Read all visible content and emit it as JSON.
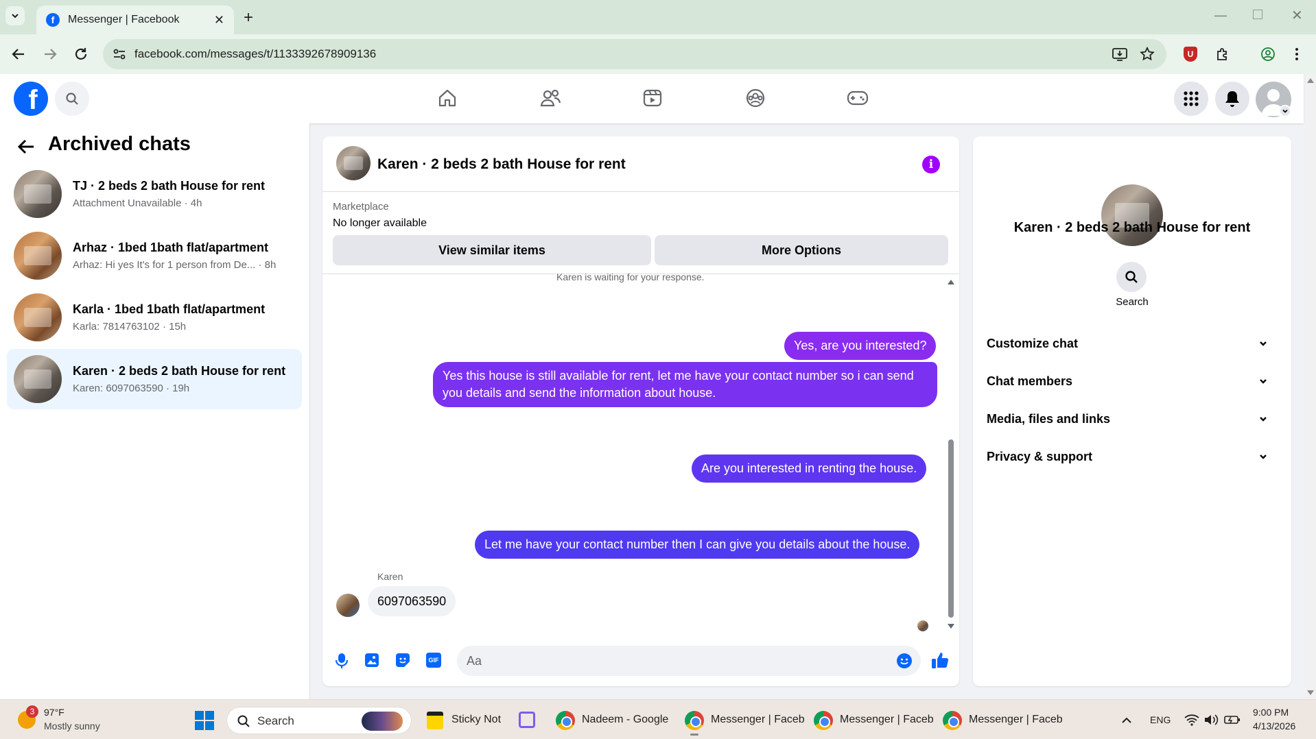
{
  "browser": {
    "tab_title": "Messenger | Facebook",
    "url": "facebook.com/messages/t/1133392678909136"
  },
  "left": {
    "title": "Archived chats",
    "chats": [
      {
        "name": "TJ · 2 beds 2 bath House for rent",
        "preview": "Attachment Unavailable · 4h"
      },
      {
        "name": "Arhaz · 1bed 1bath flat/apartment",
        "preview": "Arhaz: Hi yes It's for 1 person from De... · 8h"
      },
      {
        "name": "Karla · 1bed 1bath flat/apartment",
        "preview": "Karla: 7814763102 · 15h"
      },
      {
        "name": "Karen · 2 beds 2 bath House for rent",
        "preview": "Karen: 6097063590 · 19h"
      }
    ]
  },
  "chat": {
    "title": "Karen · 2 beds 2 bath House for rent",
    "marketplace_label": "Marketplace",
    "status": "No longer available",
    "view_similar": "View similar items",
    "more_options": "More Options",
    "waiting": "Karen is waiting for your response.",
    "messages": [
      "Yes, are you interested?",
      "Yes this house is still available for rent, let me have your contact number so i can send you details and send the information about house.",
      "Are you interested in renting the house.",
      "Let me have your contact number then I can give you details about the house."
    ],
    "incoming_sender": "Karen",
    "incoming_message": "6097063590",
    "input_placeholder": "Aa",
    "gif_label": "GIF"
  },
  "right": {
    "name": "Karen · 2 beds 2 bath House for rent",
    "search_label": "Search",
    "sections": [
      "Customize chat",
      "Chat members",
      "Media, files and links",
      "Privacy & support"
    ]
  },
  "taskbar": {
    "weather_badge": "3",
    "temperature": "97°F",
    "weather": "Mostly sunny",
    "search": "Search",
    "apps": [
      "Sticky Note",
      "Nadeem - Google",
      "Messenger | Faceb",
      "Messenger | Faceb",
      "Messenger | Faceb"
    ],
    "lang": "ENG",
    "time": "9:00 PM",
    "date": "4/13/2026"
  },
  "colors": {
    "fb_blue": "#0866ff",
    "bubble_purple": "#8a2cf0",
    "bubble_indigo": "#4f3af0",
    "active_chat": "#ebf5ff"
  }
}
